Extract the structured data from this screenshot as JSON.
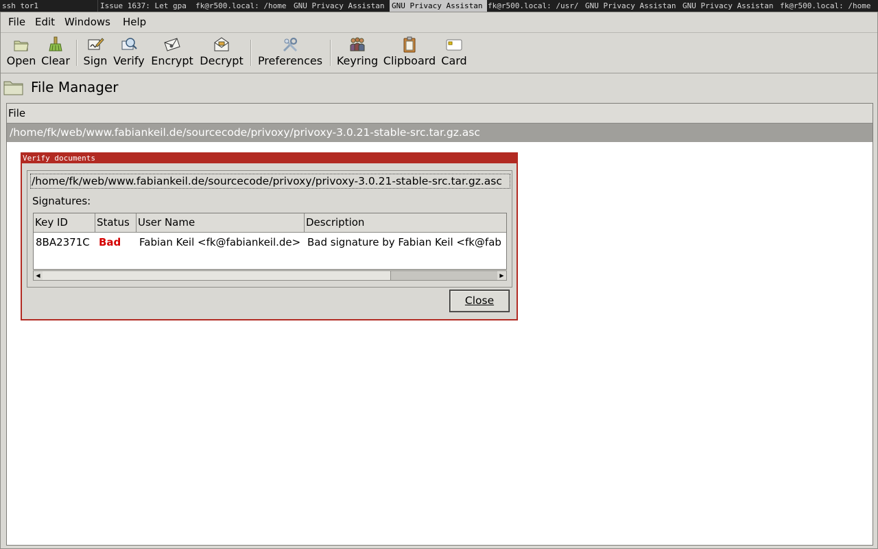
{
  "taskbar": {
    "tasks": [
      {
        "label": "ssh tor1"
      },
      {
        "label": "Issue 1637: Let gpa"
      },
      {
        "label": "fk@r500.local: /home"
      },
      {
        "label": "GNU Privacy Assistan"
      },
      {
        "label": "GNU Privacy Assistan"
      },
      {
        "label": "fk@r500.local: /usr/"
      },
      {
        "label": "GNU Privacy Assistan"
      },
      {
        "label": "GNU Privacy Assistan"
      },
      {
        "label": "fk@r500.local: /home"
      }
    ]
  },
  "menubar": {
    "items": [
      {
        "label": "File"
      },
      {
        "label": "Edit"
      },
      {
        "label": "Windows"
      },
      {
        "label": "Help"
      }
    ]
  },
  "toolbar": {
    "open": "Open",
    "clear": "Clear",
    "sign": "Sign",
    "verify": "Verify",
    "encrypt": "Encrypt",
    "decrypt": "Decrypt",
    "preferences": "Preferences",
    "keyring": "Keyring",
    "clipboard": "Clipboard",
    "card": "Card"
  },
  "file_manager": {
    "title": "File Manager",
    "column_header": "File",
    "files": [
      "/home/fk/web/www.fabiankeil.de/sourcecode/privoxy/privoxy-3.0.21-stable-src.tar.gz.asc"
    ]
  },
  "dialog": {
    "title": "Verify documents",
    "document_path": "/home/fk/web/www.fabiankeil.de/sourcecode/privoxy/privoxy-3.0.21-stable-src.tar.gz.asc",
    "signatures_label": "Signatures:",
    "columns": [
      "Key ID",
      "Status",
      "User Name",
      "Description"
    ],
    "rows": [
      {
        "key_id": "8BA2371C",
        "status": "Bad",
        "user_name": "Fabian Keil <fk@fabiankeil.de>",
        "description": "Bad signature by Fabian Keil <fk@fab"
      }
    ],
    "close_label": "Close"
  },
  "colors": {
    "dialog_border": "#b22a22",
    "bad_status": "#d40000",
    "selection": "#a09f9b"
  }
}
